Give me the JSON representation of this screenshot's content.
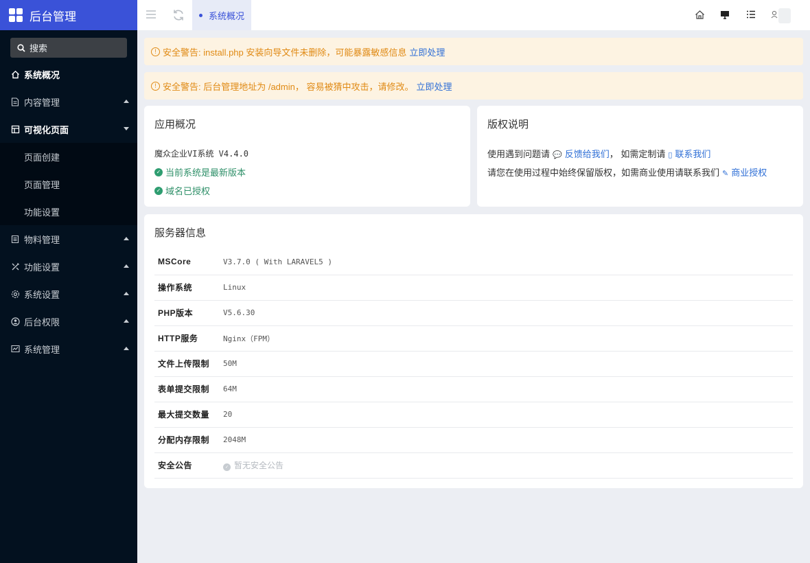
{
  "sidebar": {
    "brand": "后台管理",
    "search_label": "搜索",
    "items": [
      {
        "label": "系统概况"
      },
      {
        "label": "内容管理"
      },
      {
        "label": "可视化页面"
      },
      {
        "label": "页面创建"
      },
      {
        "label": "页面管理"
      },
      {
        "label": "功能设置"
      },
      {
        "label": "物料管理"
      },
      {
        "label": "功能设置"
      },
      {
        "label": "系统设置"
      },
      {
        "label": "后台权限"
      },
      {
        "label": "系统管理"
      }
    ]
  },
  "topbar": {
    "active_tab": "系统概况"
  },
  "alerts": [
    {
      "text": "安全警告: install.php 安装向导文件未删除，可能暴露敏感信息",
      "link": "立即处理"
    },
    {
      "text": "安全警告: 后台管理地址为 /admin， 容易被猜中攻击，请修改。",
      "link": "立即处理"
    }
  ],
  "app_overview": {
    "title": "应用概况",
    "version": "魔众企业VI系统 V4.4.0",
    "status_latest": "当前系统是最新版本",
    "status_domain": "域名已授权"
  },
  "copyright": {
    "title": "版权说明",
    "line1_prefix": "使用遇到问题请",
    "feedback_link": "反馈给我们",
    "line1_mid": "，  如需定制请",
    "contact_link": "联系我们",
    "line2_prefix": "请您在使用过程中始终保留版权，如需商业使用请联系我们",
    "license_link": "商业授权"
  },
  "server": {
    "title": "服务器信息",
    "rows": [
      {
        "key": "MSCore",
        "value": "V3.7.0 ( With LARAVEL5 )"
      },
      {
        "key": "操作系统",
        "value": "Linux"
      },
      {
        "key": "PHP版本",
        "value": "V5.6.30"
      },
      {
        "key": "HTTP服务",
        "value": "Nginx（FPM）"
      },
      {
        "key": "文件上传限制",
        "value": "50M"
      },
      {
        "key": "表单提交限制",
        "value": "64M"
      },
      {
        "key": "最大提交数量",
        "value": "20"
      },
      {
        "key": "分配内存限制",
        "value": "2048M"
      },
      {
        "key": "安全公告",
        "value": "暂无安全公告"
      }
    ]
  }
}
